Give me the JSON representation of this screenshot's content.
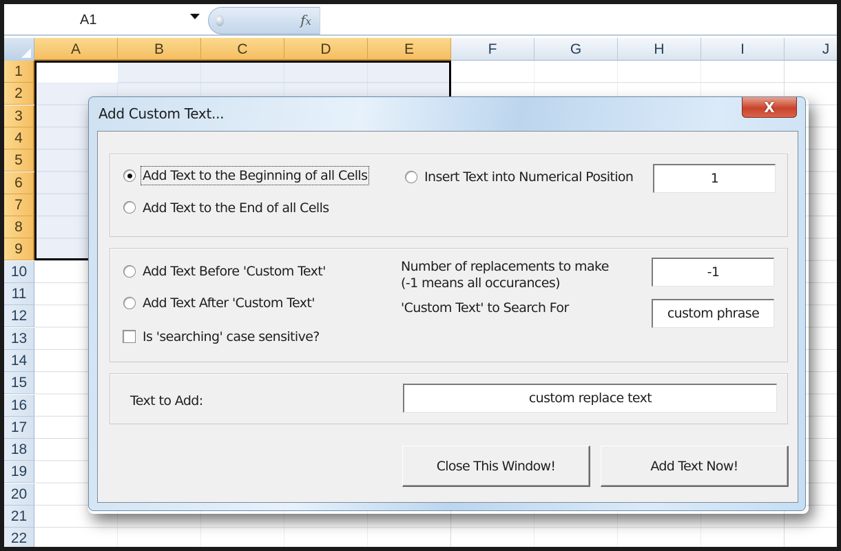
{
  "formula_bar": {
    "name_box": "A1",
    "name_box_dropdown_icon": "chevron-down-icon",
    "fx_icon": "function-icon",
    "fx_label": "fx",
    "formula_value": ""
  },
  "sheet": {
    "columns": [
      "A",
      "B",
      "C",
      "D",
      "E",
      "F",
      "G",
      "H",
      "I",
      "J"
    ],
    "rows": [
      "1",
      "2",
      "3",
      "4",
      "5",
      "6",
      "7",
      "8",
      "9",
      "10",
      "11",
      "12",
      "13",
      "14",
      "15",
      "16",
      "17",
      "18",
      "19",
      "20",
      "21",
      "22"
    ],
    "selected_range": "A1:E9",
    "active_cell": "A1",
    "colors": {
      "selected_header": "#f5be62",
      "header": "#dbe5f0"
    }
  },
  "dialog": {
    "title": "Add Custom Text...",
    "close_label": "X",
    "position_group": {
      "options": [
        {
          "label": "Add Text to the Beginning of all Cells",
          "selected": true
        },
        {
          "label": "Add Text to the End of all Cells",
          "selected": false
        },
        {
          "label": "Insert Text into Numerical Position",
          "selected": false
        }
      ],
      "numerical_position_value": "1"
    },
    "search_group": {
      "options": [
        {
          "label": "Add Text Before 'Custom Text'",
          "selected": false
        },
        {
          "label": "Add Text After 'Custom Text'",
          "selected": false
        }
      ],
      "case_sensitive_label": "Is 'searching' case sensitive?",
      "case_sensitive_checked": false,
      "replacements_label_line1": "Number of replacements to make",
      "replacements_label_line2": "(-1 means all occurances)",
      "replacements_value": "-1",
      "search_for_label": "'Custom Text' to Search For",
      "search_for_value": "custom phrase"
    },
    "text_group": {
      "label": "Text to Add:",
      "value": "custom replace text"
    },
    "buttons": {
      "close_label": "Close This Window!",
      "add_label": "Add Text Now!"
    }
  }
}
